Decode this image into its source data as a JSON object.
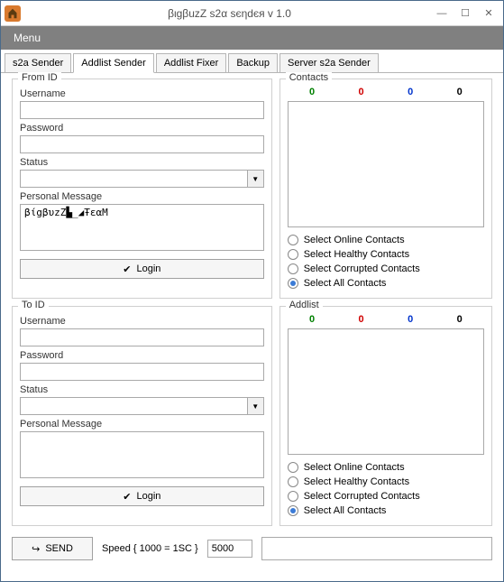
{
  "window": {
    "title": "βιgβuzZ s2α sєηdєя  v 1.0"
  },
  "menubar": {
    "menu": "Menu"
  },
  "tabs": [
    {
      "label": "s2a Sender"
    },
    {
      "label": "Addlist Sender"
    },
    {
      "label": "Addlist Fixer"
    },
    {
      "label": "Backup"
    },
    {
      "label": "Server s2a Sender"
    }
  ],
  "from": {
    "legend": "From ID",
    "username_label": "Username",
    "username": "",
    "password_label": "Password",
    "password": "",
    "status_label": "Status",
    "status": "",
    "pm_label": "Personal Message",
    "pm": "βίgβυzZ▙_◢ŦεαM",
    "login_label": "Login"
  },
  "to": {
    "legend": "To ID",
    "username_label": "Username",
    "username": "",
    "password_label": "Password",
    "password": "",
    "status_label": "Status",
    "status": "",
    "pm_label": "Personal Message",
    "pm": "",
    "login_label": "Login"
  },
  "contacts": {
    "legend": "Contacts",
    "counts": [
      "0",
      "0",
      "0",
      "0"
    ],
    "options": {
      "online": "Select Online Contacts",
      "healthy": "Select Healthy Contacts",
      "corrupted": "Select Corrupted Contacts",
      "all": "Select All Contacts"
    }
  },
  "addlist": {
    "legend": "Addlist",
    "counts": [
      "0",
      "0",
      "0",
      "0"
    ],
    "options": {
      "online": "Select Online Contacts",
      "healthy": "Select Healthy Contacts",
      "corrupted": "Select Corrupted Contacts",
      "all": "Select All Contacts"
    }
  },
  "bottom": {
    "send_label": "SEND",
    "speed_label": "Speed { 1000 = 1SC }",
    "speed_value": "5000"
  }
}
